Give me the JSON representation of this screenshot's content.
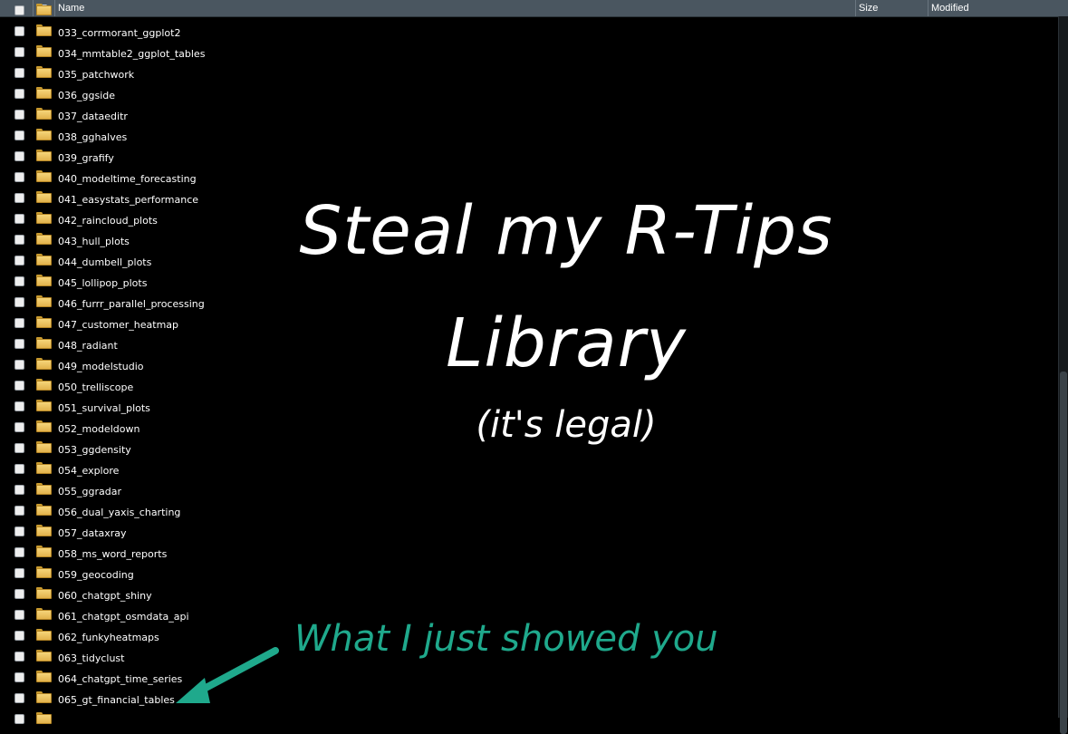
{
  "header": {
    "name_label": "Name",
    "size_label": "Size",
    "modified_label": "Modified"
  },
  "files": [
    "033_corrmorant_ggplot2",
    "034_mmtable2_ggplot_tables",
    "035_patchwork",
    "036_ggside",
    "037_dataeditr",
    "038_gghalves",
    "039_grafify",
    "040_modeltime_forecasting",
    "041_easystats_performance",
    "042_raincloud_plots",
    "043_hull_plots",
    "044_dumbell_plots",
    "045_lollipop_plots",
    "046_furrr_parallel_processing",
    "047_customer_heatmap",
    "048_radiant",
    "049_modelstudio",
    "050_trelliscope",
    "051_survival_plots",
    "052_modeldown",
    "053_ggdensity",
    "054_explore",
    "055_ggradar",
    "056_dual_yaxis_charting",
    "057_dataxray",
    "058_ms_word_reports",
    "059_geocoding",
    "060_chatgpt_shiny",
    "061_chatgpt_osmdata_api",
    "062_funkyheatmaps",
    "063_tidyclust",
    "064_chatgpt_time_series",
    "065_gt_financial_tables"
  ],
  "overlay": {
    "title_line1": "Steal my R-Tips",
    "title_line2": "Library",
    "subtitle": "(it's legal)",
    "annotation": "What I just showed you",
    "annotation_color": "#1fa98c"
  },
  "icons": {
    "folder": "folder-icon",
    "sort": "sort-desc-icon",
    "arrow": "arrow-pointer-icon"
  }
}
